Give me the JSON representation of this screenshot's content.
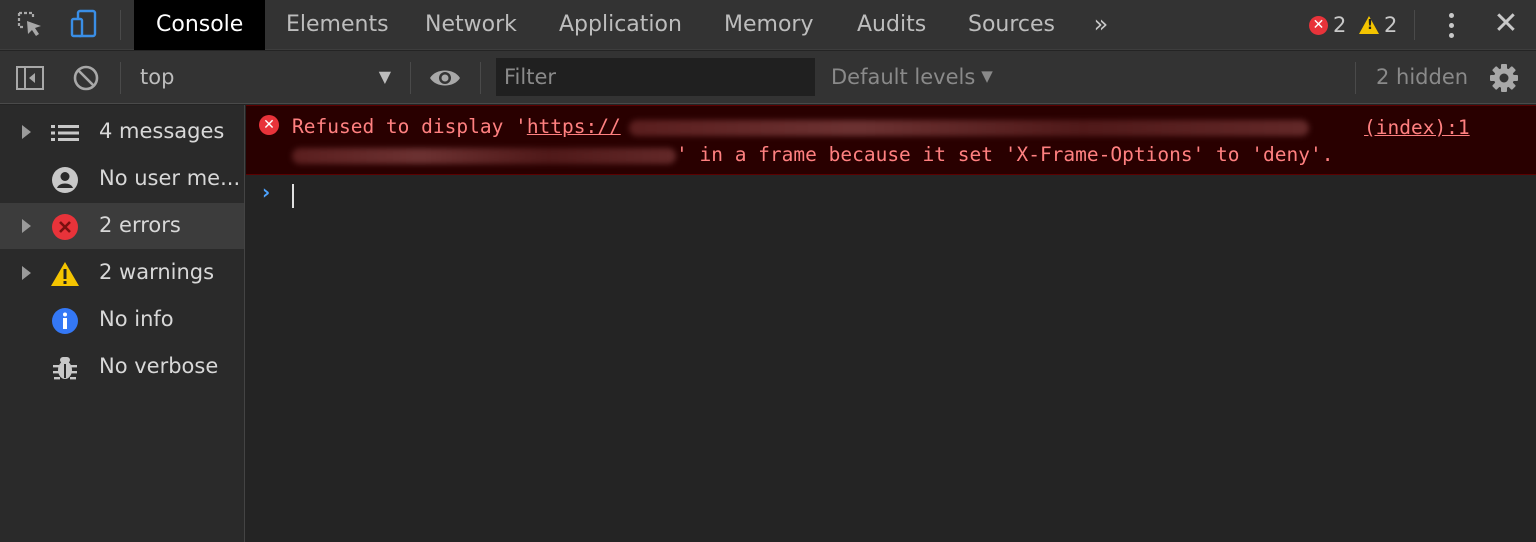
{
  "tabbar": {
    "tabs": [
      {
        "label": "Console",
        "active": true
      },
      {
        "label": "Elements"
      },
      {
        "label": "Network"
      },
      {
        "label": "Application"
      },
      {
        "label": "Memory"
      },
      {
        "label": "Audits"
      },
      {
        "label": "Sources"
      }
    ],
    "overflow": "»",
    "error_count": "2",
    "warning_count": "2",
    "close": "✕"
  },
  "toolbar": {
    "context": "top",
    "filter_placeholder": "Filter",
    "levels": "Default levels",
    "hidden": "2 hidden"
  },
  "sidebar": {
    "items": [
      {
        "label": "4 messages",
        "icon": "list-icon"
      },
      {
        "label": "No user me...",
        "icon": "user-icon"
      },
      {
        "label": "2 errors",
        "icon": "error-icon"
      },
      {
        "label": "2 warnings",
        "icon": "warning-icon"
      },
      {
        "label": "No info",
        "icon": "info-icon"
      },
      {
        "label": "No verbose",
        "icon": "bug-icon"
      }
    ]
  },
  "console": {
    "error": {
      "line1_prefix": "Refused to display '",
      "url_start": "https://",
      "line2_suffix": "' in a frame because it set 'X-Frame-Options' to 'deny'.",
      "source": "(index):1"
    }
  },
  "colors": {
    "error": "#e8333a",
    "warning": "#f4c400",
    "info": "#3478f6",
    "prompt": "#4da3ff",
    "error_text": "#ff8080",
    "error_bg": "#290000"
  }
}
